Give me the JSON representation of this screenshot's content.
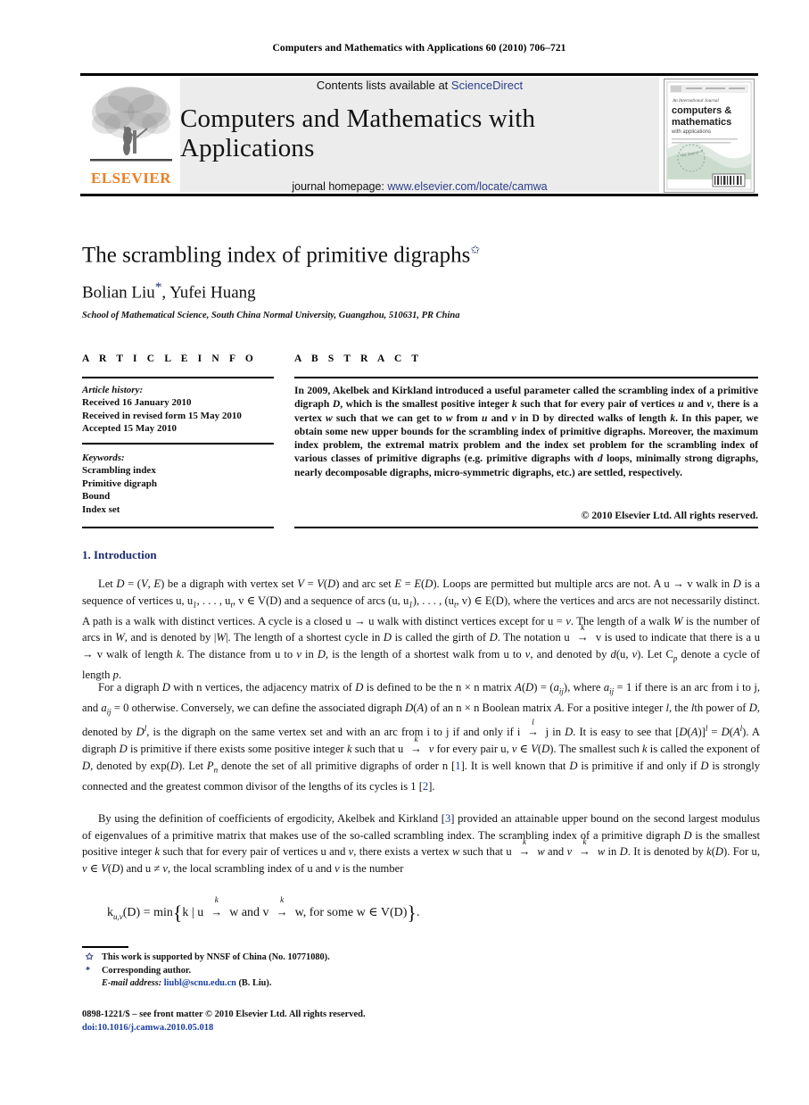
{
  "running_head": "Computers and Mathematics with Applications 60 (2010) 706–721",
  "masthead": {
    "contents_prefix": "Contents lists available at ",
    "sciencedirect": "ScienceDirect",
    "journal_title": "Computers and Mathematics with Applications",
    "homepage_prefix": "journal homepage: ",
    "homepage_url": "www.elsevier.com/locate/camwa",
    "publisher_wordmark": "ELSEVIER",
    "cover_lines": {
      "kicker": "An International Journal",
      "line1": "computers &",
      "line2": "mathematics",
      "line3": "with applications"
    },
    "link_color": "#2b3f8c",
    "brand_color": "#eb7f26",
    "panel_color": "#ececec"
  },
  "article": {
    "title": "The scrambling index of primitive digraphs",
    "title_footnote_mark": "✩",
    "authors": "Bolian Liu",
    "authors_mark": "*",
    "authors_rest": ", Yufei Huang",
    "affiliation": "School of Mathematical Science, South China Normal University, Guangzhou, 510631, PR China"
  },
  "info": {
    "heading": "A R T I C L E   I N F O",
    "history_label": "Article history:",
    "history": [
      "Received 16 January 2010",
      "Received in revised form 15 May 2010",
      "Accepted 15 May 2010"
    ],
    "keywords_label": "Keywords:",
    "keywords": [
      "Scrambling index",
      "Primitive digraph",
      "Bound",
      "Index set"
    ]
  },
  "abstract": {
    "heading": "A B S T R A C T",
    "text_part_1": "In 2009, Akelbek and Kirkland introduced a useful parameter called the scrambling index of a primitive digraph ",
    "text_part_2": ", which is the smallest positive integer ",
    "text_part_3": " such that for every pair of vertices ",
    "text_part_4": " and ",
    "text_part_5": ", there is a vertex ",
    "text_part_6": " such that we can get to ",
    "text_part_7": " from ",
    "text_part_8": " and ",
    "text_part_9": " in D by directed walks of length ",
    "text_part_10": ". In this paper, we obtain some new upper bounds for the scrambling index of primitive digraphs. Moreover, the maximum index problem, the extremal matrix problem and the index set problem for the scrambling index of various classes of primitive digraphs (e.g. primitive digraphs with ",
    "text_part_11": " loops, minimally strong digraphs, nearly decomposable digraphs, micro-symmetric digraphs, etc.) are settled, respectively.",
    "copyright": "© 2010 Elsevier Ltd. All rights reserved."
  },
  "introduction": {
    "heading": "1.  Introduction",
    "p1_a": "Let ",
    "p1_b": " be a digraph with vertex set ",
    "p1_c": " and arc set ",
    "p1_d": ". Loops are permitted but multiple arcs are not. A u → v walk in ",
    "p1_e": " is a sequence of vertices u, u",
    "p1_f": ", . . . , u",
    "p1_g": ", v ∈ V(D) and a sequence of arcs (u, u",
    "p1_h": "), . . . , (u",
    "p1_i": ", v) ∈ E(D), where the vertices and arcs are not necessarily distinct. A path is a walk with distinct vertices. A cycle is a closed u → u walk with distinct vertices except for u = ",
    "p1_j": ". The length of a walk ",
    "p1_k": " is the number of arcs in ",
    "p1_l": ", and is denoted by |",
    "p1_m": "|. The length of a shortest cycle in ",
    "p1_n": " is called the girth of ",
    "p1_o": ". The notation u ",
    "p1_p": " v is used to indicate that there is a u → v walk of length ",
    "p1_q": ". The distance from u to ",
    "p1_r": " in ",
    "p1_s": ", is the length of a shortest walk from u to ",
    "p1_t": ", and denoted by ",
    "p1_u": "(u, ",
    "p1_v": "). Let C",
    "p1_w": " denote a cycle of length ",
    "p1_x": ".",
    "p2": "For a digraph D with n vertices, the adjacency matrix of D is defined to be the n × n matrix A(D) = (aij), where aij = 1 if there is an arc from i to j, and aij = 0 otherwise. Conversely, we can define the associated digraph D(A) of an n × n Boolean matrix A. For a positive integer l, the lth power of D, denoted by Dl, is the digraph on the same vertex set and with an arc from i to j if and only if i → j in D. It is easy to see that [D(A)]l = D(Al). A digraph D is primitive if there exists some positive integer k such that u → v for every pair u, v ∈ V(D). The smallest such k is called the exponent of D, denoted by exp(D). Let Pn denote the set of all primitive digraphs of order n [1]. It is well known that D is primitive if and only if D is strongly connected and the greatest common divisor of the lengths of its cycles is 1 [2].",
    "p3": "By using the definition of coefficients of ergodicity, Akelbek and Kirkland [3] provided an attainable upper bound on the second largest modulus of eigenvalues of a primitive matrix that makes use of the so-called scrambling index. The scrambling index of a primitive digraph D is the smallest positive integer k such that for every pair of vertices u and v, there exists a vertex w such that u → w and v → w in D. It is denoted by k(D). For u, v ∈ V(D) and u ≠ v, the local scrambling index of u and v is the number",
    "citation_1": "1",
    "citation_2": "2",
    "citation_3": "3"
  },
  "equation": {
    "lhs": "k",
    "lhs_sub": "u,v",
    "lhs_rest": "(D) = min",
    "body_a": "k | u ",
    "body_b": " w and v ",
    "body_c": " w,  for some w ∈ V(D)",
    "tail": "."
  },
  "footnotes": {
    "mark_1": "✩",
    "note_1": "This work is supported by NNSF of China (No. 10771080).",
    "mark_2": "*",
    "note_2": "Corresponding author.",
    "email_label": "E-mail address:",
    "email": "liubl@scnu.edu.cn",
    "email_owner": "(B. Liu)."
  },
  "footer": {
    "issn_line": "0898-1221/$ – see front matter © 2010 Elsevier Ltd. All rights reserved.",
    "doi_line": "doi:10.1016/j.camwa.2010.05.018"
  }
}
